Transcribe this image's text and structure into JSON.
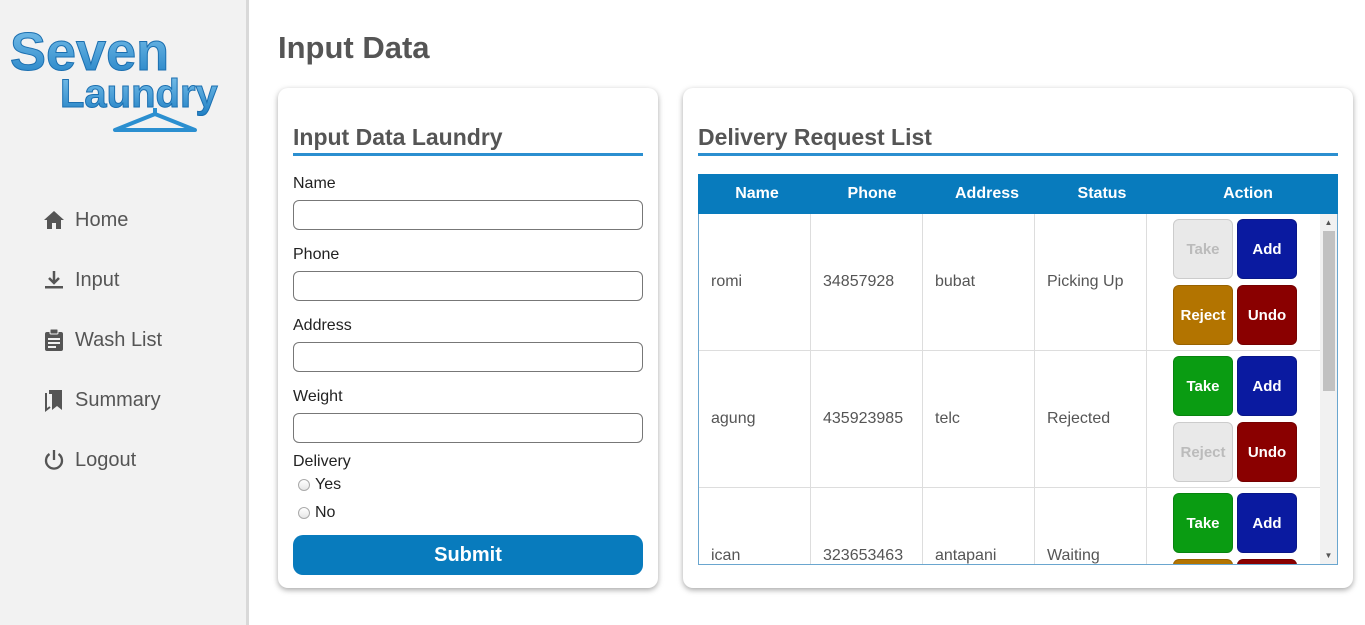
{
  "brand": {
    "line1": "Seven",
    "line2": "Laundry"
  },
  "nav": [
    {
      "label": "Home",
      "icon": "home-icon"
    },
    {
      "label": "Input",
      "icon": "download-icon"
    },
    {
      "label": "Wash List",
      "icon": "clipboard-icon"
    },
    {
      "label": "Summary",
      "icon": "bookmark-icon"
    },
    {
      "label": "Logout",
      "icon": "power-icon"
    }
  ],
  "page_title": "Input Data",
  "form": {
    "title": "Input Data Laundry",
    "fields": [
      {
        "label": "Name",
        "value": ""
      },
      {
        "label": "Phone",
        "value": ""
      },
      {
        "label": "Address",
        "value": ""
      },
      {
        "label": "Weight",
        "value": ""
      }
    ],
    "delivery_label": "Delivery",
    "options": [
      "Yes",
      "No"
    ],
    "submit_label": "Submit"
  },
  "list": {
    "title": "Delivery Request List",
    "columns": [
      "Name",
      "Phone",
      "Address",
      "Status",
      "Action"
    ],
    "buttons": {
      "take": "Take",
      "add": "Add",
      "reject": "Reject",
      "undo": "Undo"
    },
    "rows": [
      {
        "name": "romi",
        "phone": "34857928",
        "address": "bubat",
        "status": "Picking Up",
        "take_enabled": false,
        "reject_enabled": true
      },
      {
        "name": "agung",
        "phone": "435923985",
        "address": "telc",
        "status": "Rejected",
        "take_enabled": true,
        "reject_enabled": false
      },
      {
        "name": "ican",
        "phone": "323653463",
        "address": "antapani",
        "status": "Waiting",
        "take_enabled": true,
        "reject_enabled": true
      }
    ]
  },
  "colors": {
    "primary": "#087bbd",
    "take": "#0a9c12",
    "add": "#0a1aa0",
    "reject": "#b37400",
    "undo": "#8a0000"
  }
}
